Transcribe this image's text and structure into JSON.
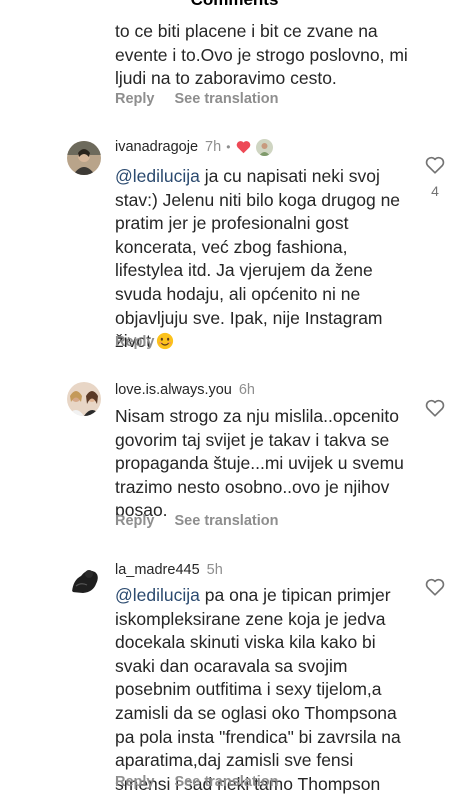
{
  "header": {
    "title": "Comments"
  },
  "comments": [
    {
      "lines": [
        "to ce biti placene i bit ce zvane na",
        "evente i to.Ovo je strogo poslovno, mi",
        "ljudi na to zaboravimo cesto."
      ],
      "reply_label": "Reply",
      "translation_label": "See translation"
    },
    {
      "username": "ivanadragoje",
      "time": "7h",
      "dot": "•",
      "mention": "@ledilucija",
      "first_line_rest": " ja cu napisati neki svoj",
      "lines": [
        "stav:) Jelenu niti bilo koga drugog ne",
        "pratim jer je profesionalni gost",
        "koncerata, već zbog fashiona,",
        "lifestylea itd. Ja vjerujem da žene",
        "svuda hodaju, ali općenito ni ne",
        "objavljuju sve. Ipak, nije Instagram",
        "život"
      ],
      "emoji": "smiling-face-emoji",
      "like_count": "4",
      "reply_label": "Reply"
    },
    {
      "username": "love.is.always.you",
      "time": "6h",
      "lines": [
        "Nisam strogo za nju mislila..opcenito",
        "govorim taj svijet je takav i takva se",
        "propaganda štuje...mi uvijek u svemu",
        "trazimo nesto osobno..ovo je njihov",
        "posao."
      ],
      "reply_label": "Reply",
      "translation_label": "See translation"
    },
    {
      "username": "la_madre445",
      "time": "5h",
      "mention": "@ledilucija",
      "first_line_rest": " pa ona je tipican primjer",
      "lines": [
        "iskompleksirane zene koja je jedva",
        "docekala skinuti viska kila kako bi",
        "svaki dan ocaravala sa svojim",
        "posebnim outfitima i sexy tijelom,a",
        "zamisli da se oglasi oko Thompsona",
        "pa pola insta \"frendica\" bi zavrsila na",
        "aparatima,daj zamisli sve fensi",
        "smensi i sad neki tamo Thompson"
      ],
      "reply_label": "Reply",
      "translation_label": "See translation"
    }
  ],
  "colors": {
    "mention": "#2b4a6f",
    "heart_red": "#ed4956",
    "secondary": "#8e8e8e"
  }
}
